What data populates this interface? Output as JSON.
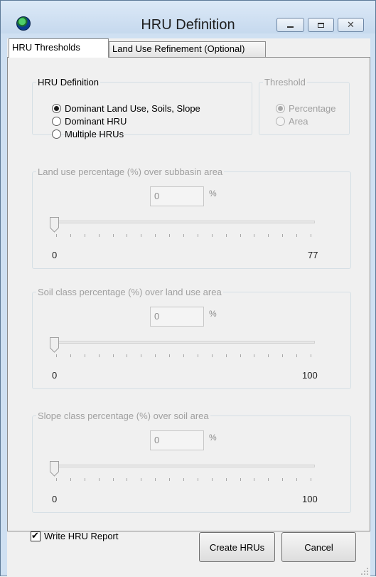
{
  "window": {
    "title": "HRU Definition"
  },
  "tabs": [
    {
      "label": "HRU Thresholds"
    },
    {
      "label": "Land Use Refinement (Optional)"
    }
  ],
  "hru_definition": {
    "legend": "HRU Definition",
    "options": [
      {
        "label": "Dominant Land Use, Soils, Slope",
        "checked": true
      },
      {
        "label": "Dominant HRU",
        "checked": false
      },
      {
        "label": "Multiple HRUs",
        "checked": false
      }
    ]
  },
  "threshold": {
    "legend": "Threshold",
    "options": [
      {
        "label": "Percentage",
        "checked": true
      },
      {
        "label": "Area",
        "checked": false
      }
    ]
  },
  "land_use": {
    "legend": "Land use percentage (%) over subbasin area",
    "value": "0",
    "unit": "%",
    "min": "0",
    "max": "77",
    "level": 0
  },
  "soil": {
    "legend": "Soil class percentage (%) over land use area",
    "value": "0",
    "unit": "%",
    "min": "0",
    "max": "100",
    "level": 0
  },
  "slope": {
    "legend": "Slope class percentage (%) over soil area",
    "value": "0",
    "unit": "%",
    "min": "0",
    "max": "100",
    "level": 0
  },
  "footer": {
    "write_report_label": "Write HRU Report",
    "write_report_checked": true,
    "create_label": "Create HRUs",
    "cancel_label": "Cancel"
  },
  "icons": [
    "globe-icon",
    "minimize-icon",
    "maximize-icon",
    "close-icon",
    "slider-thumb-icon",
    "resize-grip-icon"
  ]
}
